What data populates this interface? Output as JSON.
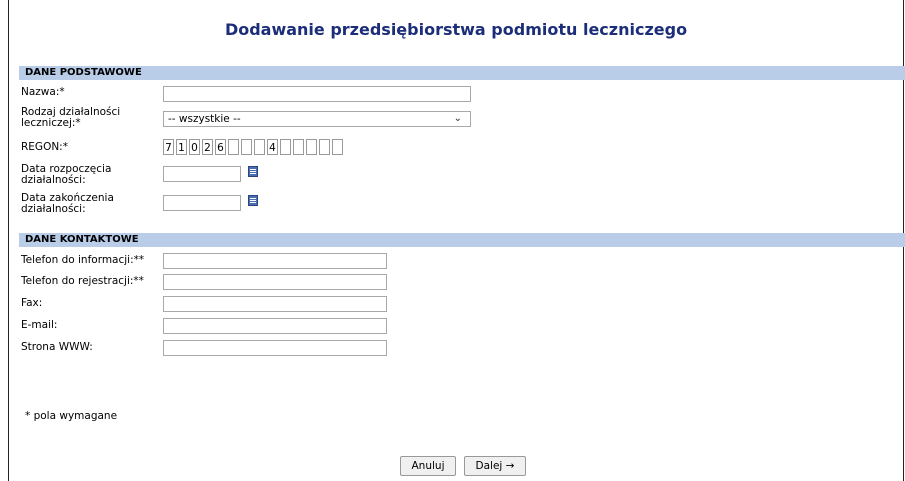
{
  "page": {
    "title": "Dodawanie przedsiębiorstwa podmiotu leczniczego"
  },
  "basic": {
    "header": "DANE PODSTAWOWE",
    "name_label": "Nazwa:*",
    "type_label": "Rodzaj działalności leczniczej:*",
    "type_value": "-- wszystkie --",
    "regon_label": "REGON:*",
    "regon_cells": [
      "7",
      "1",
      "0",
      "2",
      "6",
      "",
      "",
      "",
      "4",
      "",
      "",
      "",
      "",
      ""
    ],
    "start_label": "Data rozpoczęcia działalności:",
    "end_label": "Data zakończenia działalności:"
  },
  "contact": {
    "header": "DANE KONTAKTOWE",
    "phone_info_label": "Telefon do informacji:**",
    "phone_reg_label": "Telefon do rejestracji:**",
    "fax_label": "Fax:",
    "email_label": "E-mail:",
    "www_label": "Strona WWW:"
  },
  "footer": {
    "required_note": "* pola wymagane",
    "cancel_label": "Anuluj",
    "next_label": "Dalej →"
  },
  "icons": {
    "calendar": "calendar-icon",
    "dropdown": "chevron-down-icon"
  }
}
